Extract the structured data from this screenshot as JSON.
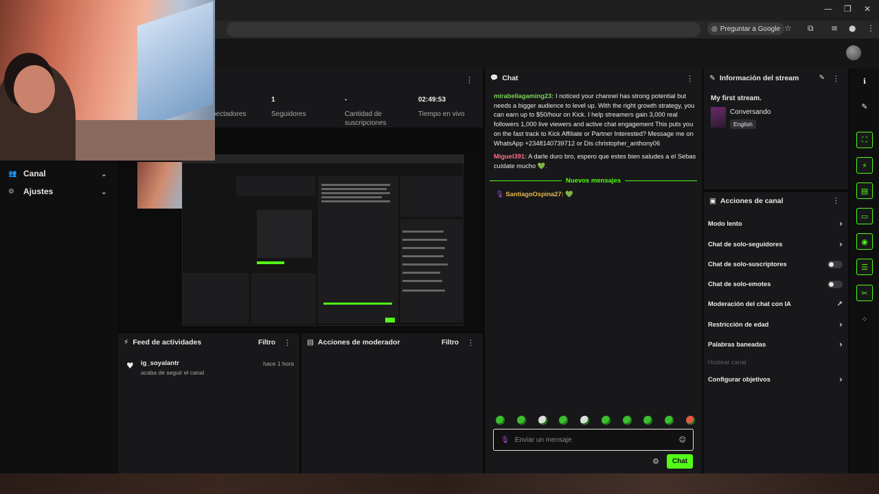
{
  "browser": {
    "google_button": "Preguntar a Google",
    "window_controls": [
      "minimize-icon",
      "restore-icon",
      "close-icon"
    ]
  },
  "sidebar": {
    "items": [
      {
        "label": "Canal",
        "icon": "users-icon"
      },
      {
        "label": "Ajustes",
        "icon": "gear-icon"
      }
    ]
  },
  "stats": {
    "items": [
      {
        "value": "",
        "label": "pectadores"
      },
      {
        "value": "1",
        "label": "Seguidores"
      },
      {
        "value": "-",
        "label": "Cantidad de suscripciones"
      },
      {
        "value": "02:49:53",
        "label": "Tiempo en vivo"
      }
    ]
  },
  "chat": {
    "title": "Chat",
    "messages": [
      {
        "user": "mirabellagaming23",
        "user_color": "#7bd35a",
        "text": "I noticed your channel has strong potential but needs a bigger audience to level up. With the right growth strategy, you can earn up to $50/hour on Kick. I help streamers gain 3,000 real followers 1,000 live viewers and active chat engagement This puts you on the fast track to Kick Affiliate or Partner Interested? Message me on WhatsApp +2348140739712 or Dis christopher_anthony06"
      },
      {
        "user": "Miguel391",
        "user_color": "#ff6f8a",
        "text": "A darle duro bro, espero que estes bien saludes a el Sebas cuídate mucho 💚."
      }
    ],
    "new_messages_label": "Nuevos mensajes",
    "after_messages": [
      {
        "user": "SantiagoOspina27",
        "user_color": "#e6b84a",
        "text": "💚"
      }
    ],
    "input_placeholder": "Enviar un mensaje",
    "send_label": "Chat"
  },
  "stream_info": {
    "title": "Información del stream",
    "stream_title": "My first stream.",
    "category": "Conversando",
    "language": "English"
  },
  "channel_actions": {
    "title": "Acciones de canal",
    "rows": [
      {
        "label": "Modo lento",
        "control": "chevron"
      },
      {
        "label": "Chat de solo-seguidores",
        "control": "chevron"
      },
      {
        "label": "Chat de solo-suscriptores",
        "control": "toggle"
      },
      {
        "label": "Chat de solo-emotes",
        "control": "toggle"
      },
      {
        "label": "Moderación del chat con IA",
        "control": "external"
      },
      {
        "label": "Restricción de edad",
        "control": "chevron"
      },
      {
        "label": "Palabras baneadas",
        "control": "chevron"
      },
      {
        "label": "Hostear canal",
        "control": "disabled"
      },
      {
        "label": "Configurar objetivos",
        "control": "chevron"
      }
    ]
  },
  "activity_feed": {
    "title": "Feed de actividades",
    "filter_label": "Filtro",
    "items": [
      {
        "user": "ig_soyalantr",
        "action": "acaba de seguir el canal",
        "time": "hace 1 hora"
      }
    ]
  },
  "mod_actions": {
    "title": "Acciones de moderador",
    "filter_label": "Filtro"
  },
  "colors": {
    "accent": "#53fc18",
    "panel": "#18181a",
    "background": "#0b0b0c"
  }
}
